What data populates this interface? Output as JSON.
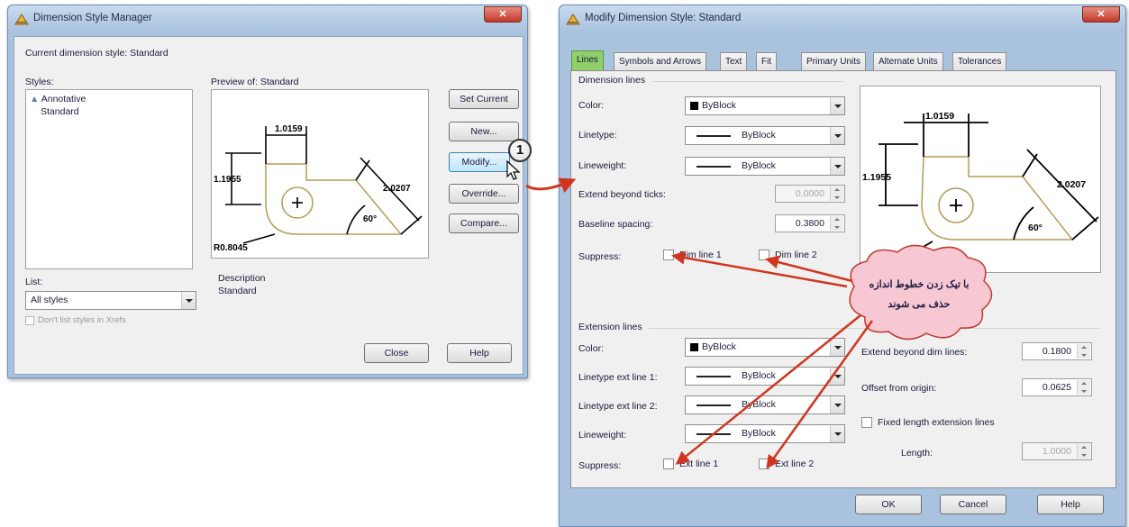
{
  "manager": {
    "title": "Dimension Style Manager",
    "current_style_text": "Current dimension style: Standard",
    "styles_label": "Styles:",
    "styles": [
      "Annotative",
      "Standard"
    ],
    "preview_label": "Preview of: Standard",
    "list_label": "List:",
    "list_value": "All styles",
    "dont_list_label": "Don't list styles in Xrefs",
    "description_label": "Description",
    "description_value": "Standard",
    "buttons": {
      "set_current": "Set Current",
      "new": "New...",
      "modify": "Modify...",
      "override": "Override...",
      "compare": "Compare...",
      "close": "Close",
      "help": "Help"
    }
  },
  "preview": {
    "dim_top": "1.0159",
    "dim_left": "1.1955",
    "dim_diag": "2.0207",
    "angle": "60°",
    "radius": "R0.8045"
  },
  "callout": {
    "number": "1"
  },
  "modify": {
    "title": "Modify Dimension Style: Standard",
    "tabs": [
      "Lines",
      "Symbols and Arrows",
      "Text",
      "Fit",
      "Primary Units",
      "Alternate Units",
      "Tolerances"
    ],
    "dim_lines": {
      "group": "Dimension lines",
      "color_label": "Color:",
      "color_value": "ByBlock",
      "linetype_label": "Linetype:",
      "linetype_value": "ByBlock",
      "lineweight_label": "Lineweight:",
      "lineweight_value": "ByBlock",
      "extend_label": "Extend beyond ticks:",
      "extend_value": "0.0000",
      "baseline_label": "Baseline spacing:",
      "baseline_value": "0.3800",
      "suppress_label": "Suppress:",
      "dim_line_1": "Dim line 1",
      "dim_line_2": "Dim line 2"
    },
    "ext_lines": {
      "group": "Extension lines",
      "color_label": "Color:",
      "color_value": "ByBlock",
      "linetype1_label": "Linetype ext line 1:",
      "linetype1_value": "ByBlock",
      "linetype2_label": "Linetype ext line 2:",
      "linetype2_value": "ByBlock",
      "lineweight_label": "Lineweight:",
      "lineweight_value": "ByBlock",
      "suppress_label": "Suppress:",
      "ext_line_1": "Ext line 1",
      "ext_line_2": "Ext line 2",
      "extend_label": "Extend beyond dim lines:",
      "extend_value": "0.1800",
      "offset_label": "Offset from origin:",
      "offset_value": "0.0625",
      "fixed_label": "Fixed length extension lines",
      "length_label": "Length:",
      "length_value": "1.0000"
    },
    "buttons": {
      "ok": "OK",
      "cancel": "Cancel",
      "help": "Help"
    }
  },
  "annotation": {
    "line1": "با تیک زدن خطوط اندازه",
    "line2": "حذف می شوند"
  },
  "colors": {
    "arrow_red": "#d0361f",
    "active_tab": "#8fd06a",
    "preview_shape": "#b89a55",
    "cloud_fill": "#f7c7d3",
    "cloud_stroke": "#c0392b"
  }
}
